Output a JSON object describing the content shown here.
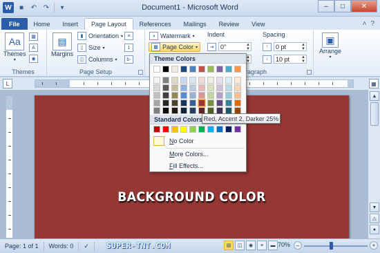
{
  "window": {
    "title": "Document1 - Microsoft Word"
  },
  "tabs": [
    "File",
    "Home",
    "Insert",
    "Page Layout",
    "References",
    "Mailings",
    "Review",
    "View"
  ],
  "ribbon": {
    "themes_group": {
      "themes_label": "Themes",
      "group_label": "Themes"
    },
    "page_setup": {
      "margins_label": "Margins",
      "orientation_label": "Orientation",
      "size_label": "Size",
      "columns_label": "Columns",
      "group_label": "Page Setup"
    },
    "page_background": {
      "watermark_label": "Watermark",
      "page_color_label": "Page Color"
    },
    "paragraph": {
      "indent_label": "Indent",
      "spacing_label": "Spacing",
      "indent_left_value": "0\"",
      "indent_right_value": "0\"",
      "spacing_before_value": "0 pt",
      "spacing_after_value": "10 pt",
      "group_label_partial": "aragraph"
    },
    "arrange": {
      "arrange_label": "Arrange"
    }
  },
  "page_color_menu": {
    "theme_colors_header": "Theme Colors",
    "standard_colors_header": "Standard Colors",
    "no_color_label": "No Color",
    "no_color_key": "N",
    "more_colors_label": "More Colors...",
    "more_colors_key": "M",
    "fill_effects_label": "Fill Effects...",
    "fill_effects_key": "F",
    "theme_top_row": [
      "#ffffff",
      "#000000",
      "#eeece1",
      "#1f497d",
      "#4f81bd",
      "#c0504d",
      "#9bbb59",
      "#8064a2",
      "#4bacc6",
      "#f79646"
    ],
    "theme_shades": [
      [
        "#f2f2f2",
        "#7f7f7f",
        "#ddd9c3",
        "#c6d9f0",
        "#dbe5f1",
        "#f2dcdb",
        "#ebf1dd",
        "#e5e0ec",
        "#dbeef3",
        "#fdeada"
      ],
      [
        "#d8d8d8",
        "#595959",
        "#c4bd97",
        "#8db3e2",
        "#b8cce4",
        "#e5b9b7",
        "#d7e3bc",
        "#ccc1d9",
        "#b7dde8",
        "#fbd5b5"
      ],
      [
        "#bfbfbf",
        "#3f3f3f",
        "#938953",
        "#548dd4",
        "#95b3d7",
        "#d99694",
        "#c3d69b",
        "#b2a2c7",
        "#92cddc",
        "#fac08f"
      ],
      [
        "#a5a5a5",
        "#262626",
        "#494429",
        "#17365d",
        "#366092",
        "#953734",
        "#76923c",
        "#5f497a",
        "#31859b",
        "#e36c09"
      ],
      [
        "#7f7f7f",
        "#0c0c0c",
        "#1d1b10",
        "#0f243e",
        "#244061",
        "#632423",
        "#4f6128",
        "#3f3151",
        "#205867",
        "#974806"
      ]
    ],
    "standard_row": [
      "#c00000",
      "#ff0000",
      "#ffc000",
      "#ffff00",
      "#92d050",
      "#00b050",
      "#00b0f0",
      "#0070c0",
      "#002060",
      "#7030a0"
    ],
    "selected_swatch_tooltip": "Red, Accent 2, Darker 25%"
  },
  "document": {
    "page_color": "#953735",
    "text": "BACKGROUND COLOR"
  },
  "status": {
    "page": "Page: 1 of 1",
    "words": "Words: 0",
    "watermark": "SUPER-TNT.COM",
    "zoom": "70%"
  }
}
